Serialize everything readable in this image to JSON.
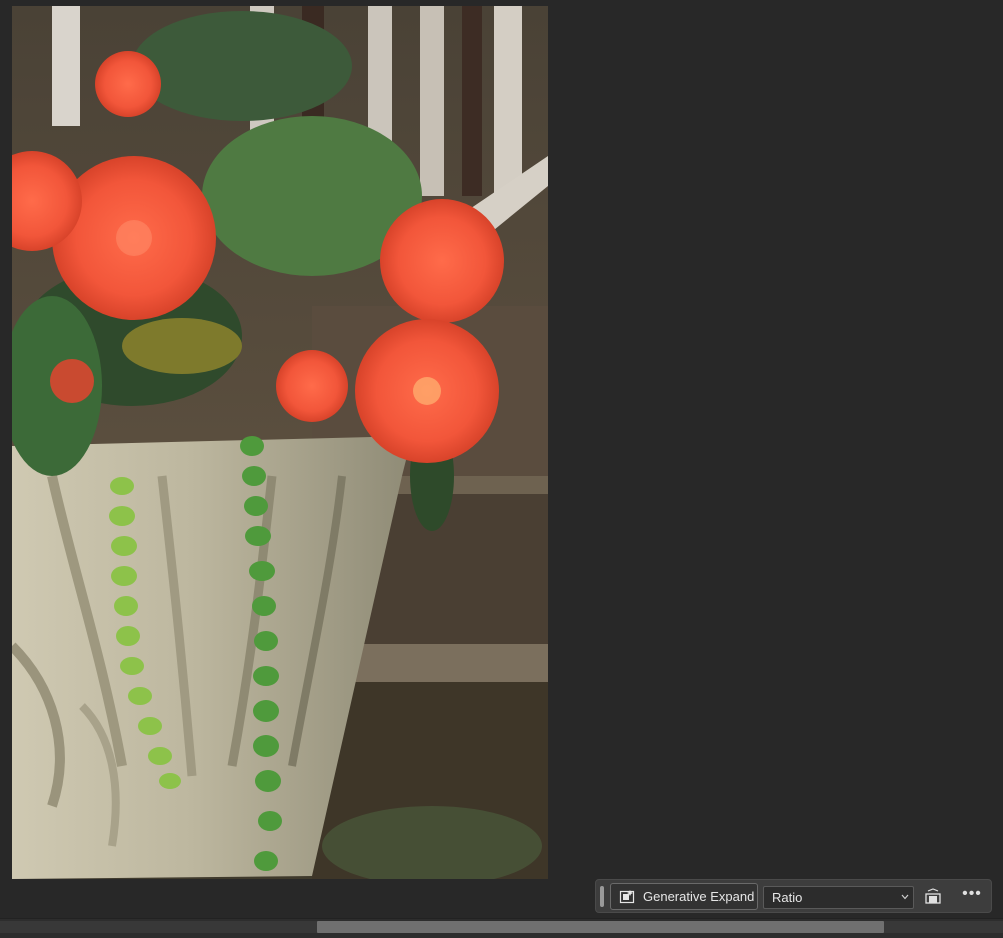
{
  "canvas": {
    "image_alt_name": "begonia-planter-photo"
  },
  "taskbar": {
    "generative_expand_label": "Generative Expand",
    "generative_expand_icon": "generative-expand-icon",
    "ratio_value": "Ratio",
    "ratio_chevron_icon": "chevron-down-icon",
    "orientation_icon": "swap-orientation-icon",
    "more_label": "•••"
  },
  "scrollbar": {
    "horizontal_position_fraction": 0.32,
    "horizontal_visible_fraction": 0.57
  }
}
